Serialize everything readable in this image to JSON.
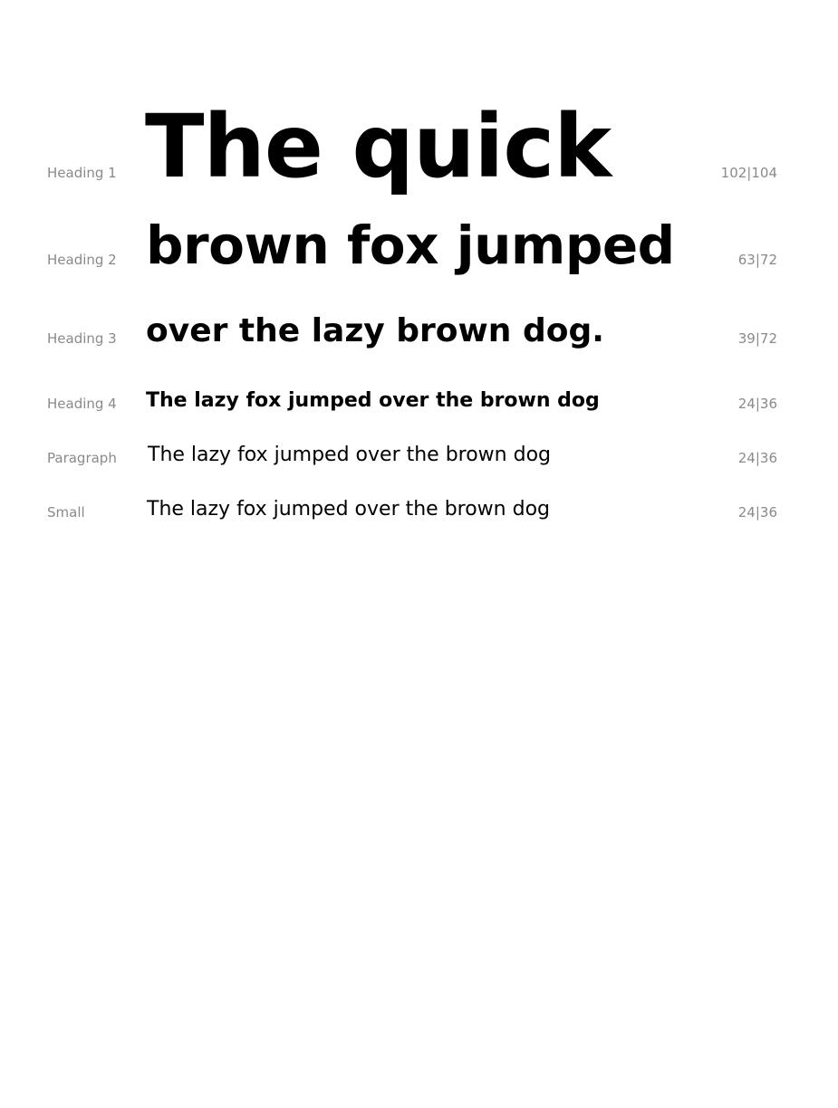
{
  "rows": [
    {
      "label": "Heading 1",
      "sample": "The quick",
      "spec": "102|104"
    },
    {
      "label": "Heading 2",
      "sample": "brown fox jumped",
      "spec": "63|72"
    },
    {
      "label": "Heading 3",
      "sample": "over the lazy brown dog.",
      "spec": "39|72"
    },
    {
      "label": "Heading 4",
      "sample": "The lazy fox jumped over the brown dog",
      "spec": "24|36"
    },
    {
      "label": "Paragraph",
      "sample": "The lazy fox jumped over the brown dog",
      "spec": "24|36"
    },
    {
      "label": "Small",
      "sample": "The lazy fox jumped over the brown dog",
      "spec": "24|36"
    }
  ]
}
